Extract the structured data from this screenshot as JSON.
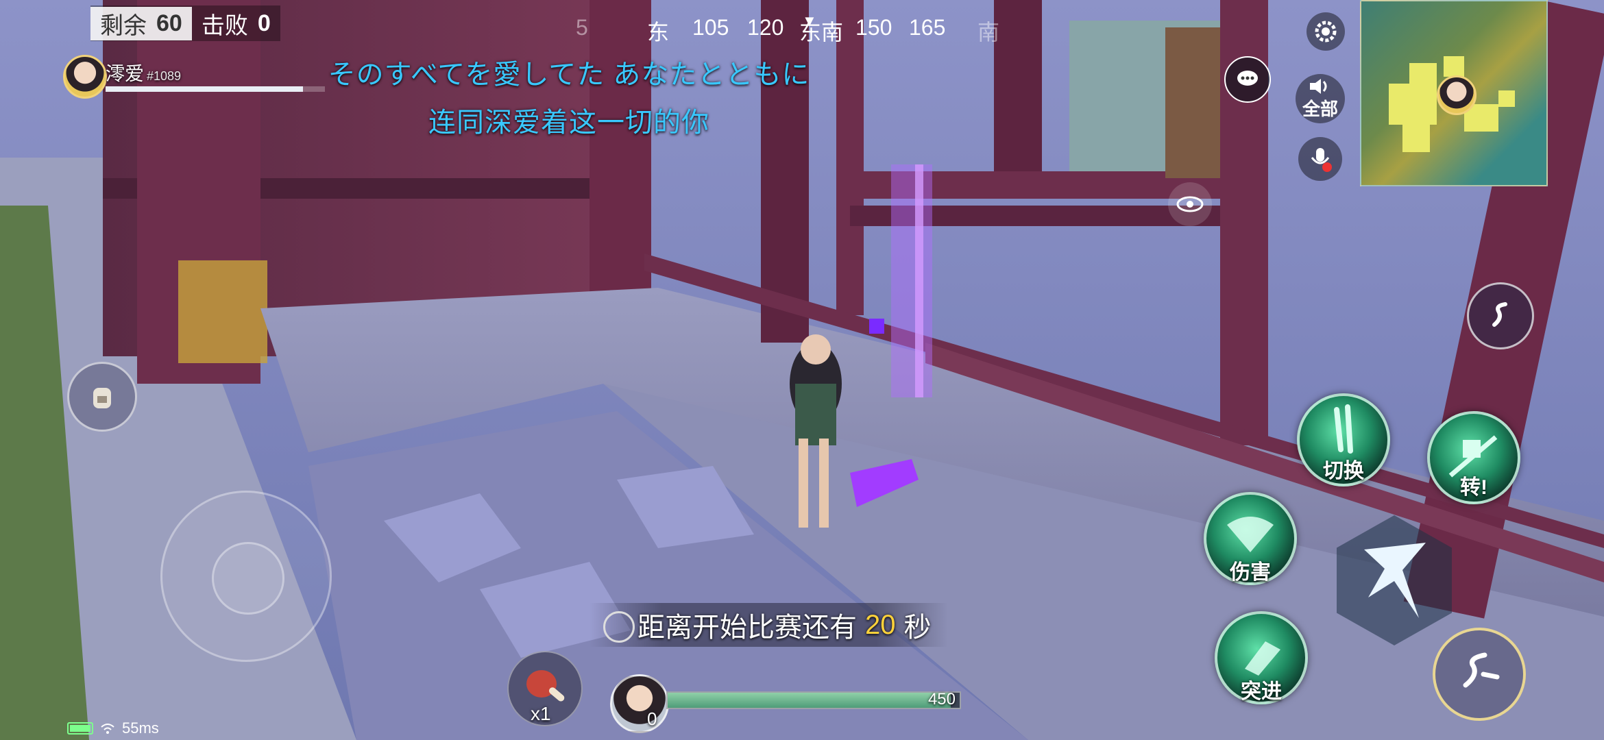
{
  "hud": {
    "remaining_label": "剩余",
    "remaining_value": "60",
    "defeat_label": "击败",
    "defeat_value": "0",
    "player_name": "澪爱",
    "player_id": "#1089",
    "player_hp_fraction": 0.9
  },
  "compass": {
    "ticks": [
      "5",
      "东",
      "105",
      "120",
      "东南",
      "150",
      "165",
      "南"
    ],
    "marker_glyph": "▼"
  },
  "lyrics": {
    "japanese": "そのすべてを愛してた あなたとともに",
    "chinese": "连同深爱着这一切的你"
  },
  "top_right": {
    "settings_icon": "gear-icon",
    "chat_icon": "chat-bubble-icon",
    "voice_label": "全部",
    "mic_icon": "mic-muted-icon",
    "spectate_icon": "eye-icon"
  },
  "skills": {
    "switch_label": "切换",
    "turn_label": "转!",
    "damage_label": "伤害",
    "dash_label": "突进"
  },
  "bottom": {
    "countdown_prefix": "距离开始比赛还有",
    "countdown_value": "20",
    "countdown_suffix": "秒",
    "hp_value": "450",
    "hp_fraction": 0.97,
    "level": "0",
    "item_count": "x1",
    "ping": "55ms"
  },
  "colors": {
    "lyric": "#39c8ff",
    "countdown_number": "#ffd23a",
    "skill_green": "#1f8b62",
    "battery": "#7dff8d"
  }
}
